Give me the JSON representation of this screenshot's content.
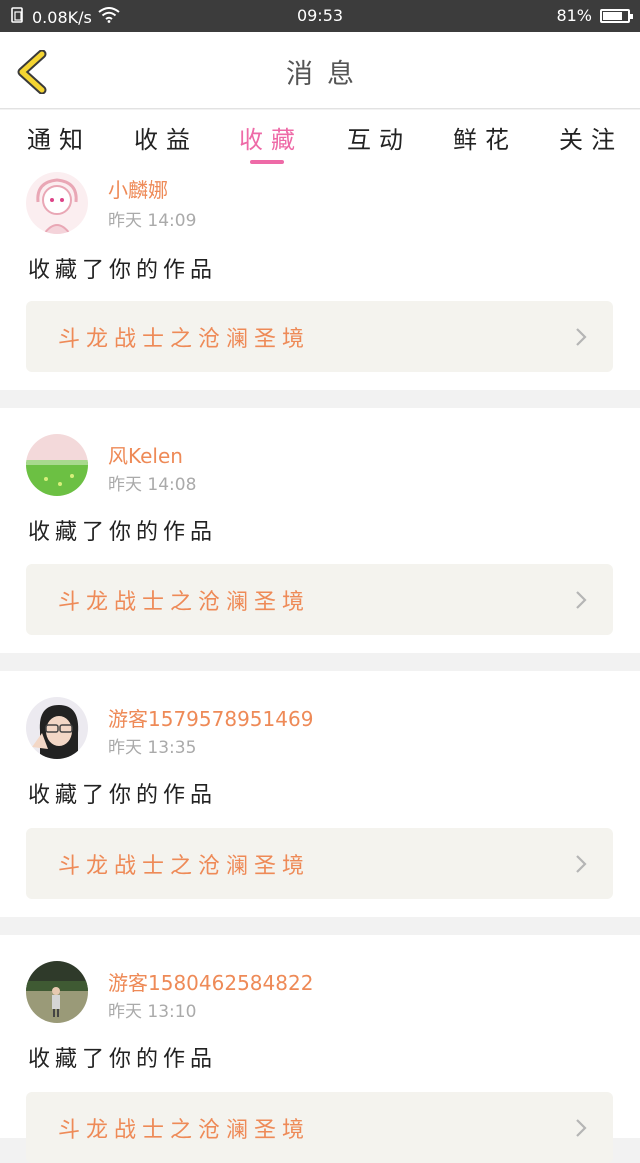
{
  "status_bar": {
    "speed": "0.08K/s",
    "time": "09:53",
    "battery": "81%",
    "battery_level": 0.81,
    "icons": [
      "data-saver-icon",
      "wifi-icon",
      "battery-icon"
    ]
  },
  "header": {
    "title": "消息",
    "back_icon": "chevron-left-icon"
  },
  "tabs": [
    {
      "label": "通知"
    },
    {
      "label": "收益"
    },
    {
      "label": "收藏"
    },
    {
      "label": "互动"
    },
    {
      "label": "鲜花"
    },
    {
      "label": "关注"
    }
  ],
  "active_tab": "收藏",
  "colors": {
    "accent": "#ee6aa7",
    "name_orange": "#ee8a57",
    "work_bg": "#f4f3ee",
    "status_bar": "#3c3c3c"
  },
  "messages": [
    {
      "user": "小麟娜",
      "time": "昨天 14:09",
      "action": "收藏了你的作品",
      "work": "斗龙战士之沧澜圣境"
    },
    {
      "user": "风Kelen",
      "time": "昨天 14:08",
      "action": "收藏了你的作品",
      "work": "斗龙战士之沧澜圣境"
    },
    {
      "user": "游客1579578951469",
      "time": "昨天 13:35",
      "action": "收藏了你的作品",
      "work": "斗龙战士之沧澜圣境"
    },
    {
      "user": "游客1580462584822",
      "time": "昨天 13:10",
      "action": "收藏了你的作品",
      "work": "斗龙战士之沧澜圣境"
    }
  ]
}
